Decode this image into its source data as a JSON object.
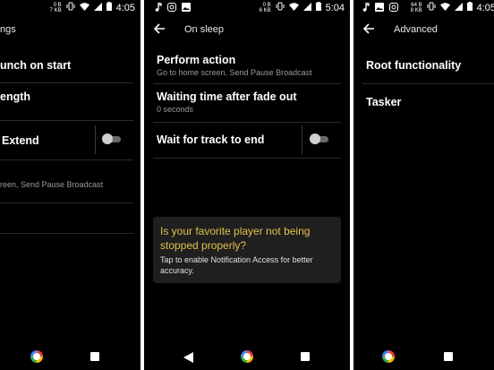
{
  "panels": [
    {
      "status": {
        "speed_top": "0 B",
        "speed_bottom": "7 KB",
        "clock": "4:05"
      },
      "appbar": {
        "title": "ngs"
      },
      "items": {
        "launch_on_start": "unch on start",
        "length": "ength",
        "extend": "Extend",
        "action_desc": "reen, Send Pause Broadcast"
      }
    },
    {
      "status": {
        "speed_top": "0 B",
        "speed_bottom": "6 KB",
        "clock": "5:04"
      },
      "appbar": {
        "title": "On sleep"
      },
      "items": {
        "perform_action": "Perform action",
        "perform_action_desc": "Go to home screen, Send Pause Broadcast",
        "waiting_time": "Waiting time after fade out",
        "waiting_time_desc": "0 seconds",
        "wait_for_track": "Wait for track to end"
      },
      "card": {
        "question": "Is your favorite player not being stopped properly?",
        "description": "Tap to enable Notification Access for better accuracy."
      }
    },
    {
      "status": {
        "speed_top": "64 B",
        "speed_bottom": "8 KB",
        "clock": "4:05"
      },
      "appbar": {
        "title": "Advanced"
      },
      "items": {
        "root": "Root functionality",
        "tasker": "Tasker"
      }
    }
  ],
  "toggles": {
    "extend": false,
    "wait_for_track": false
  },
  "colors": {
    "background": "#000000",
    "card_question": "#e3c14a",
    "secondary_text": "#9a9a9a"
  },
  "icons": [
    "music-note-icon",
    "instagram-icon",
    "image-icon",
    "vibrate-icon",
    "wifi-icon",
    "cell-signal-icon",
    "battery-icon",
    "back-arrow-icon",
    "home-icon",
    "recents-icon"
  ]
}
